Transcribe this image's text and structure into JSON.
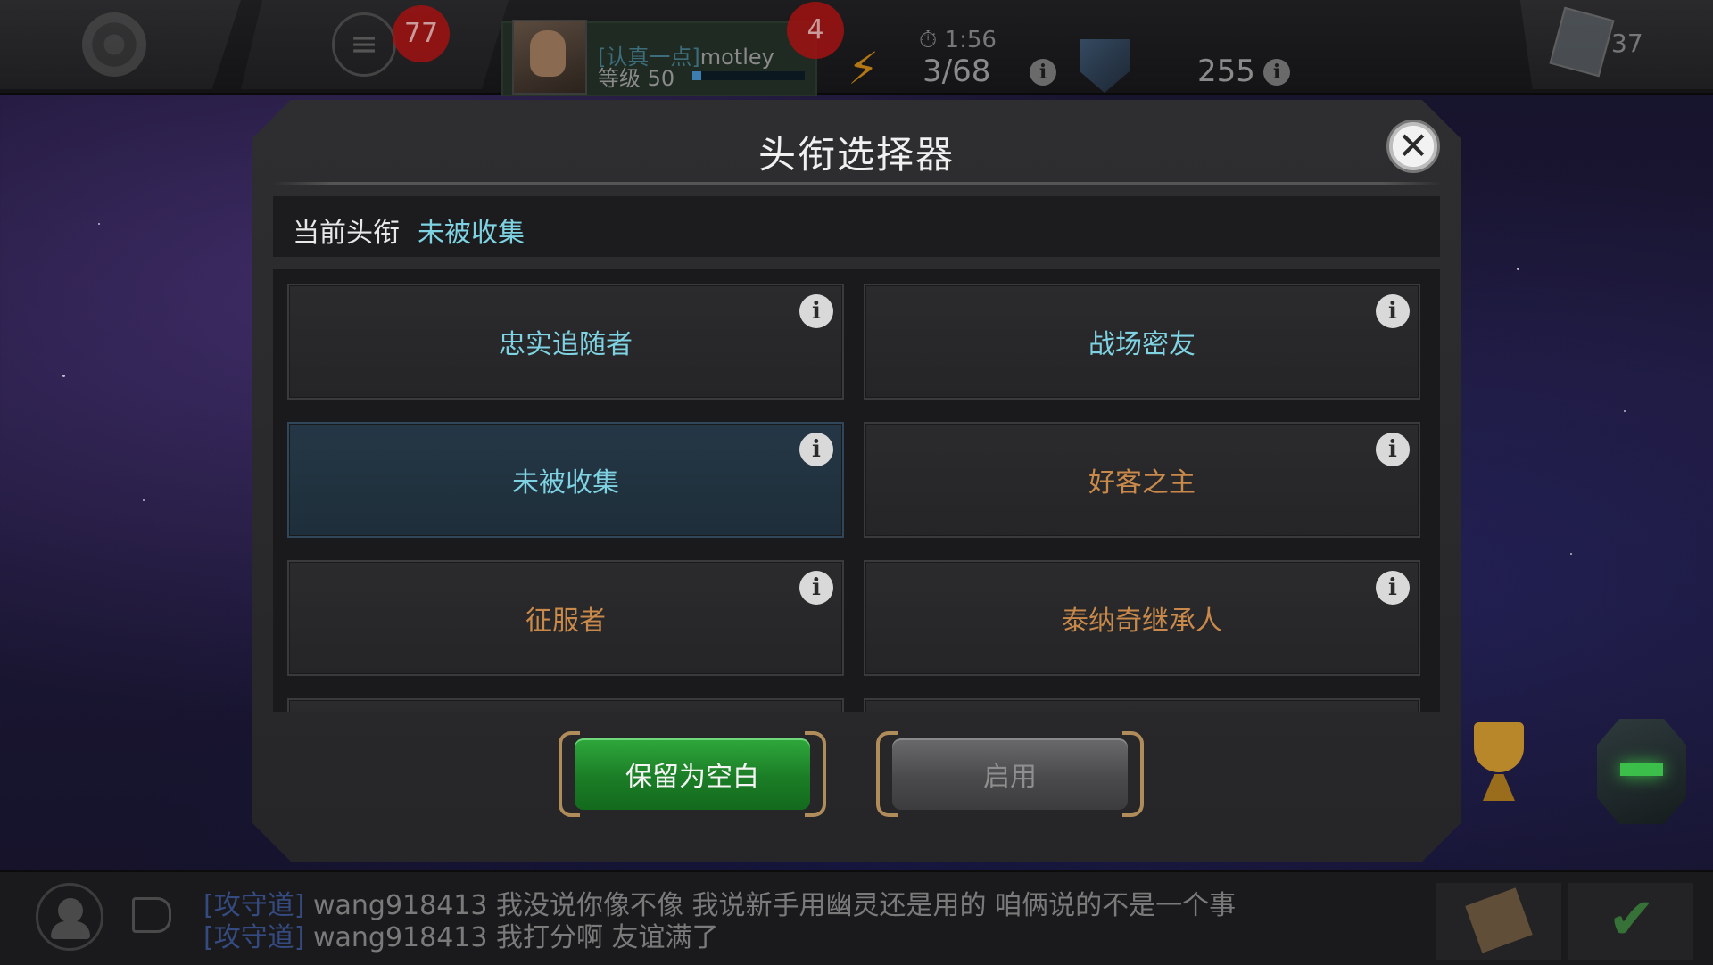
{
  "top_bar": {
    "notifications_count": "77",
    "alliance_badge_count": "4",
    "profile": {
      "tag": "[认真一点]",
      "name": "motley",
      "level_label": "等级 50",
      "xp_progress": 0.08
    },
    "energy": {
      "timer": "1:56",
      "count": "3/68"
    },
    "currency": {
      "count": "255"
    },
    "cards": {
      "count": "37"
    }
  },
  "modal": {
    "title": "头衔选择器",
    "close_symbol": "✕",
    "current_title_label": "当前头衔",
    "current_title_value": "未被收集",
    "titles": [
      {
        "label": "忠实追随者",
        "color": "cyan",
        "selected": false
      },
      {
        "label": "战场密友",
        "color": "cyan",
        "selected": false
      },
      {
        "label": "未被收集",
        "color": "cyan",
        "selected": true
      },
      {
        "label": "好客之主",
        "color": "orange",
        "selected": false
      },
      {
        "label": "征服者",
        "color": "orange",
        "selected": false
      },
      {
        "label": "泰纳奇继承人",
        "color": "orange",
        "selected": false
      }
    ],
    "info_symbol": "i",
    "buttons": {
      "keep_blank": "保留为空白",
      "enable": "启用"
    }
  },
  "chat": {
    "lines": [
      {
        "channel": "[攻守道]",
        "user": "wang918413",
        "message": "我没说你像不像 我说新手用幽灵还是用的 咱俩说的不是一个事"
      },
      {
        "channel": "[攻守道]",
        "user": "wang918413",
        "message": "我打分啊 友谊满了"
      }
    ]
  },
  "colors": {
    "accent_cyan": "#7ed2e2",
    "accent_orange": "#c8894a",
    "button_green": "#1b7d26",
    "badge_red": "#a11212"
  }
}
